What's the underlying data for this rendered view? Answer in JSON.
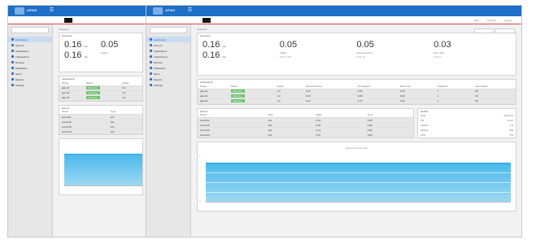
{
  "app": {
    "brand": "APINS"
  },
  "sidebar": {
    "items": [
      {
        "label": "Dashboard"
      },
      {
        "label": "Servers"
      },
      {
        "label": "Applications"
      },
      {
        "label": "Transactions"
      },
      {
        "label": "Browser"
      },
      {
        "label": "Databases"
      },
      {
        "label": "Alerts"
      },
      {
        "label": "Reports"
      },
      {
        "label": "Settings"
      }
    ]
  },
  "top_links": [
    "Help",
    "Account",
    "Logout"
  ],
  "breadcrumb": "Overview",
  "overview": {
    "title": "Overview",
    "left_values": [
      "0.16",
      "0.16"
    ],
    "left_small": "ms",
    "metrics": [
      {
        "value": "0.05",
        "label": "Apdex",
        "sub": "0.50 / 0.50"
      },
      {
        "value": "0.05",
        "label": "Response time",
        "sub": "0.50 ms"
      },
      {
        "value": "0.03",
        "label": "Error rate",
        "sub": "0.00 %"
      }
    ]
  },
  "apps_table": {
    "title": "Applications",
    "headers": [
      "Name",
      "Status",
      "Apdex",
      "Response time",
      "Throughput",
      "Error rate",
      "Instances",
      "Last update"
    ],
    "rows": [
      [
        "app-01",
        "Running",
        "1.0",
        "0.12",
        "0.60",
        "0.00",
        "1",
        "0.0"
      ],
      [
        "app-02",
        "Running",
        "1.0",
        "0.15",
        "0.80",
        "0.00",
        "1",
        "0.0"
      ],
      [
        "app-03",
        "Running",
        "1.0",
        "0.14",
        "0.70",
        "0.00",
        "1",
        "0.0"
      ]
    ]
  },
  "events_table": {
    "title": "Events",
    "headers": [
      "Name",
      "Type",
      "Value",
      "Time"
    ],
    "rows": [
      [
        "event-01",
        "info",
        "0.12",
        "0.00"
      ],
      [
        "event-02",
        "info",
        "0.15",
        "0.00"
      ],
      [
        "event-03",
        "info",
        "0.14",
        "0.00"
      ],
      [
        "event-04",
        "info",
        "0.10",
        "0.00"
      ]
    ]
  },
  "details": {
    "title": "Details",
    "rows": [
      {
        "k": "Host",
        "v": "server01"
      },
      {
        "k": "OS",
        "v": "Linux"
      },
      {
        "k": "Version",
        "v": "1.0"
      },
      {
        "k": "Uptime",
        "v": "12d"
      },
      {
        "k": "CPU",
        "v": "2%"
      }
    ]
  },
  "chart": {
    "legend": "Response time (ms)"
  },
  "colors": {
    "brand": "#1e6fc6",
    "chart": "#4ab9ec",
    "status": "#6cc06c"
  }
}
